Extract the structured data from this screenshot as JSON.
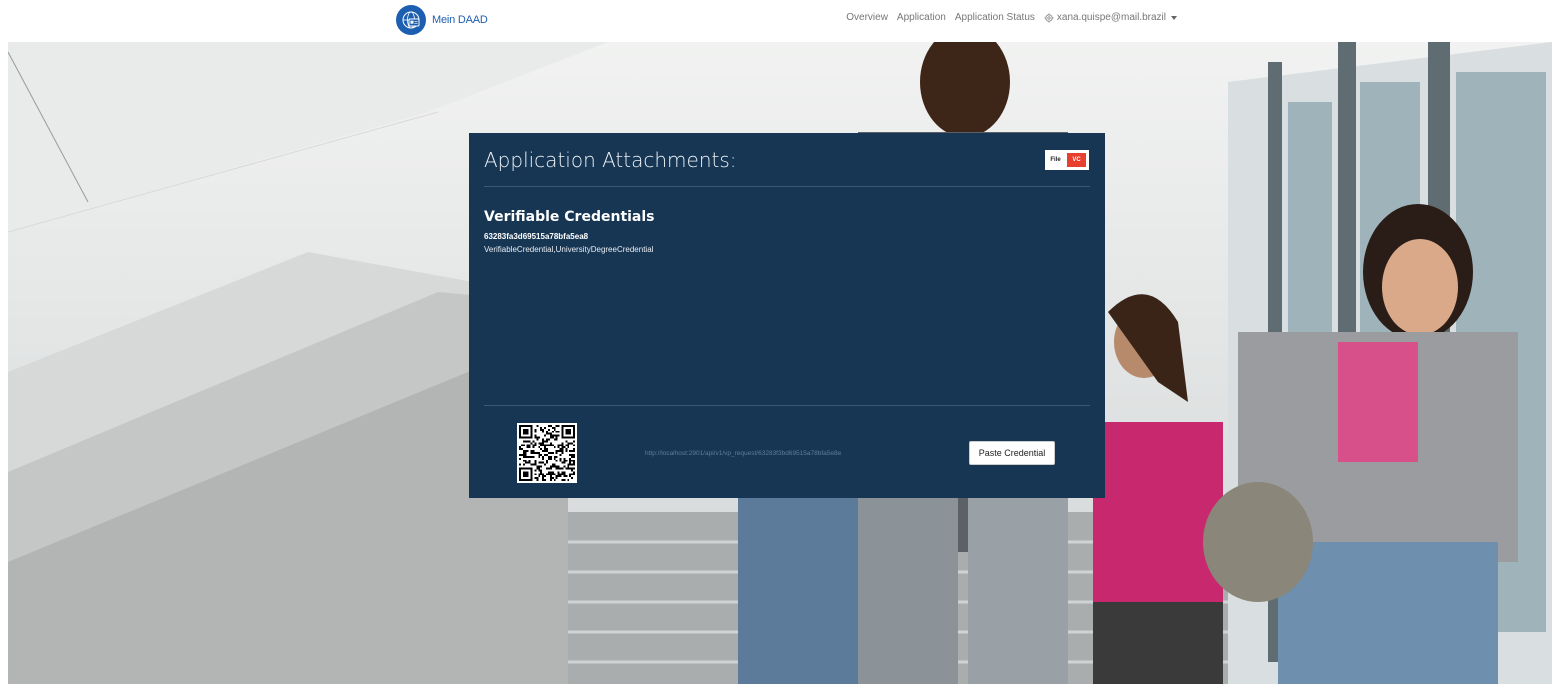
{
  "brand": {
    "name": "Mein DAAD",
    "logo_icon": "globe-id-card-icon",
    "color": "#1c5fb0"
  },
  "nav": {
    "links": [
      "Overview",
      "Application",
      "Application Status"
    ],
    "user": {
      "icon": "gear-icon",
      "email": "xana.quispe@mail.brazil"
    }
  },
  "panel": {
    "title": "Application Attachments:",
    "background": "#163654",
    "toggle": {
      "file_label": "File",
      "vc_label": "VC",
      "active": "VC",
      "active_color": "#e8402f"
    },
    "section_title": "Verifiable Credentials",
    "credential": {
      "id": "63283fa3d69515a78bfa5ea8",
      "types": "VerifiableCredential,UniversityDegreeCredential"
    },
    "vp_request_url": "http://localhost:2901/api/v1/vp_request/63283f3bd69515a78bfa5e8e",
    "paste_button": "Paste Credential",
    "qr_icon": "qr-code-icon"
  }
}
